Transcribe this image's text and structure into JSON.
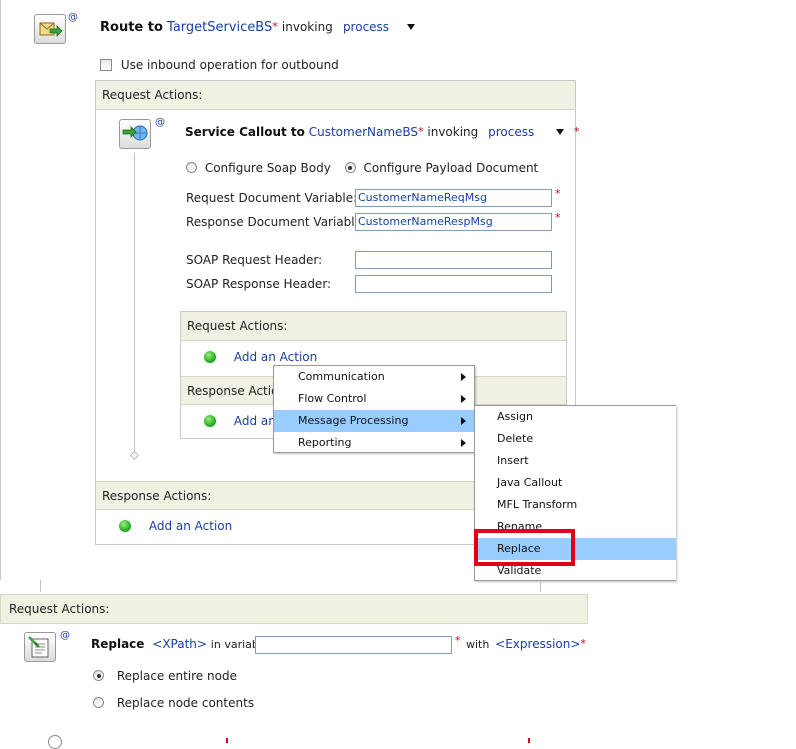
{
  "route": {
    "prefix": "Route to",
    "service": "TargetServiceBS",
    "invoking": "invoking",
    "operation": "process",
    "use_inbound_label": "Use inbound operation for outbound"
  },
  "request_actions_label": "Request Actions:",
  "service_callout": {
    "prefix": "Service Callout to",
    "service": "CustomerNameBS",
    "invoking": "invoking",
    "operation": "process",
    "configure_soap_body": "Configure Soap Body",
    "configure_payload": "Configure Payload Document",
    "request_doc_label": "Request Document Variable:",
    "request_doc_value": "CustomerNameReqMsg",
    "response_doc_label": "Response Document Variable:",
    "response_doc_value": "CustomerNameRespMsg",
    "soap_request_header_label": "SOAP Request Header:",
    "soap_response_header_label": "SOAP Response Header:",
    "inner_request_actions": "Request Actions:",
    "inner_response_actions": "Response Actio",
    "add_action": "Add an Action",
    "add_action_partial": "Add an"
  },
  "response_actions_label": "Response Actions:",
  "add_action": "Add an Action",
  "context_menu": {
    "items": [
      "Communication",
      "Flow Control",
      "Message Processing",
      "Reporting"
    ],
    "selected": "Message Processing"
  },
  "submenu": {
    "items": [
      "Assign",
      "Delete",
      "Insert",
      "Java Callout",
      "MFL Transform",
      "Rename",
      "Replace",
      "Validate"
    ],
    "selected": "Replace"
  },
  "bottom": {
    "header": "Request Actions:",
    "replace_label": "Replace",
    "xpath": "<XPath>",
    "in_variable": "in variable",
    "with": "with",
    "expression": "<Expression>",
    "entire_node": "Replace entire node",
    "node_contents": "Replace node contents"
  },
  "at_sign": "@",
  "required_mark": "*",
  "colors": {
    "link": "#1a3fa6",
    "required": "#d0021b",
    "panel_header": "#f0f0e3",
    "menu_selected": "#99ccff",
    "highlight_box": "#e0001a"
  }
}
